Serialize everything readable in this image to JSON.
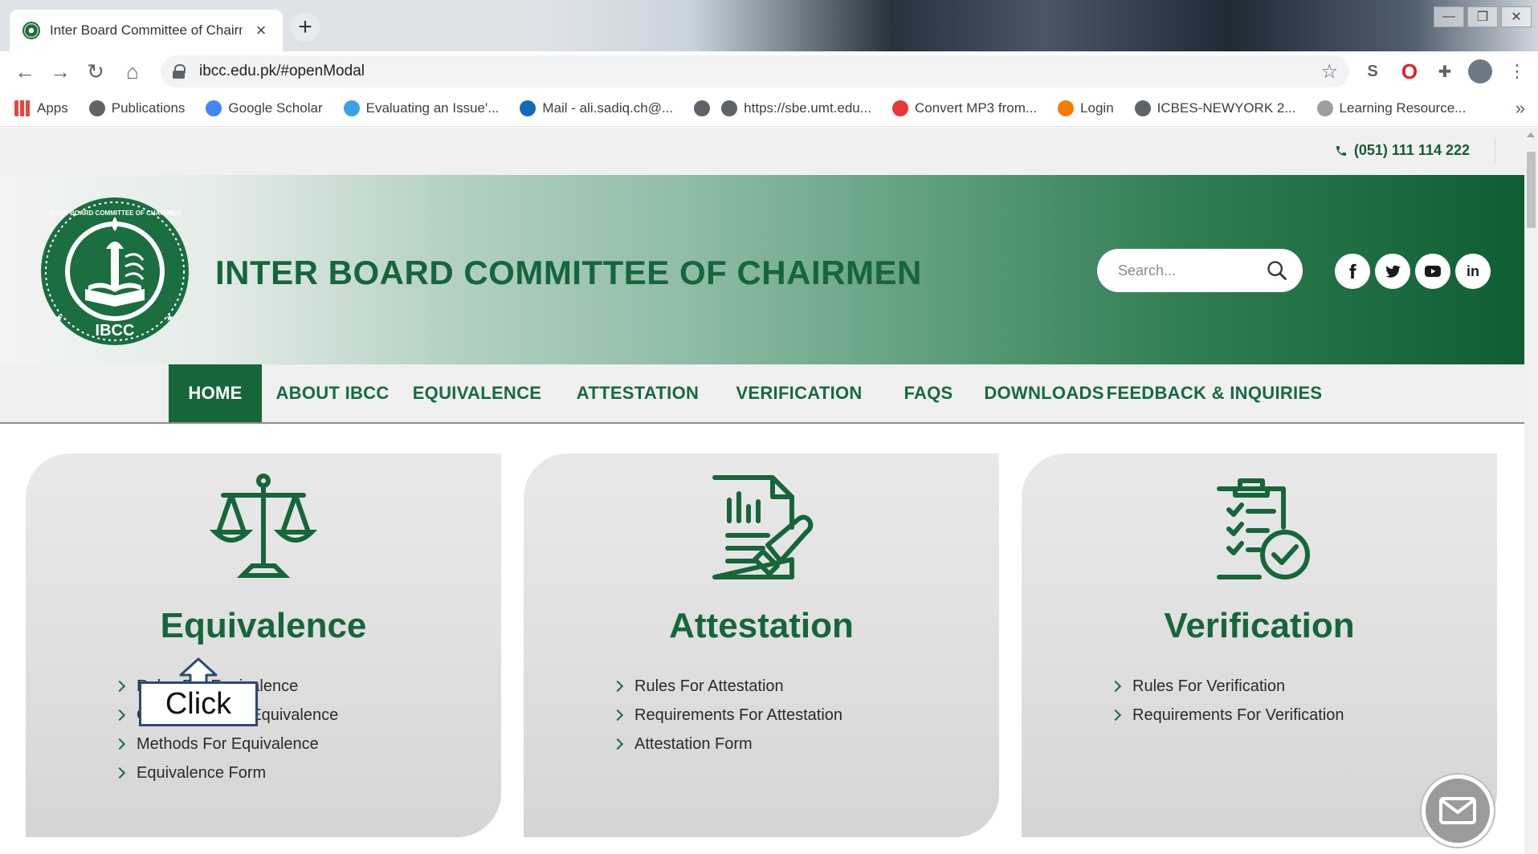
{
  "browser": {
    "tab_title": "Inter Board Committee of Chairm",
    "new_tab": "+",
    "url": "ibcc.edu.pk/#openModal",
    "bookmarks": [
      {
        "label": "Apps",
        "icon": "apps-grid-icon",
        "color": "#e8453c"
      },
      {
        "label": "Publications",
        "icon": "globe-icon",
        "color": "#5f6368"
      },
      {
        "label": "Google Scholar",
        "icon": "scholar-icon",
        "color": "#4285f4"
      },
      {
        "label": "Evaluating an Issue'...",
        "icon": "chrome-app-icon",
        "color": "#3aa1e8"
      },
      {
        "label": "Mail - ali.sadiq.ch@...",
        "icon": "outlook-icon",
        "color": "#0f6cbd"
      },
      {
        "label": "",
        "icon": "globe-icon",
        "color": "#5f6368"
      },
      {
        "label": "https://sbe.umt.edu...",
        "icon": "globe-icon",
        "color": "#5f6368"
      },
      {
        "label": "Convert MP3 from...",
        "icon": "download-icon",
        "color": "#e53935"
      },
      {
        "label": "Login",
        "icon": "login-icon",
        "color": "#f57c00"
      },
      {
        "label": "ICBES-NEWYORK 2...",
        "icon": "globe-icon",
        "color": "#5f6368"
      },
      {
        "label": "Learning Resource...",
        "icon": "learning-icon",
        "color": "#9e9e9e"
      }
    ],
    "more_bookmarks": "»"
  },
  "site": {
    "phone": "(051) 111 114 222",
    "title": "INTER BOARD COMMITTEE OF CHAIRMEN",
    "logo_text_top": "INTER BOARD COMMITTEE OF CHAIRMEN",
    "logo_text_bottom": "IBCC",
    "search_placeholder": "Search...",
    "social": [
      {
        "name": "facebook",
        "glyph": "f"
      },
      {
        "name": "twitter",
        "glyph": "t"
      },
      {
        "name": "youtube",
        "glyph": "▶"
      },
      {
        "name": "linkedin",
        "glyph": "in"
      }
    ],
    "nav": [
      {
        "label": "HOME",
        "active": true
      },
      {
        "label": "ABOUT IBCC",
        "active": false
      },
      {
        "label": "EQUIVALENCE",
        "active": false
      },
      {
        "label": "ATTESTATION",
        "active": false
      },
      {
        "label": "VERIFICATION",
        "active": false
      },
      {
        "label": "FAQS",
        "active": false
      },
      {
        "label": "DOWNLOADS",
        "active": false
      },
      {
        "label": "FEEDBACK & INQUIRIES",
        "active": false
      }
    ],
    "cards": [
      {
        "title": "Equivalence",
        "icon": "scales-icon",
        "links": [
          "Rules For Equivalence",
          "Conversion For Equivalence",
          "Methods For Equivalence",
          "Equivalence Form"
        ]
      },
      {
        "title": "Attestation",
        "icon": "document-stamp-icon",
        "links": [
          "Rules For Attestation",
          "Requirements For Attestation",
          "Attestation Form"
        ]
      },
      {
        "title": "Verification",
        "icon": "clipboard-check-icon",
        "links": [
          "Rules For Verification",
          "Requirements For Verification"
        ]
      }
    ],
    "accent_color": "#16663a"
  },
  "annotation": {
    "label": "Click"
  }
}
